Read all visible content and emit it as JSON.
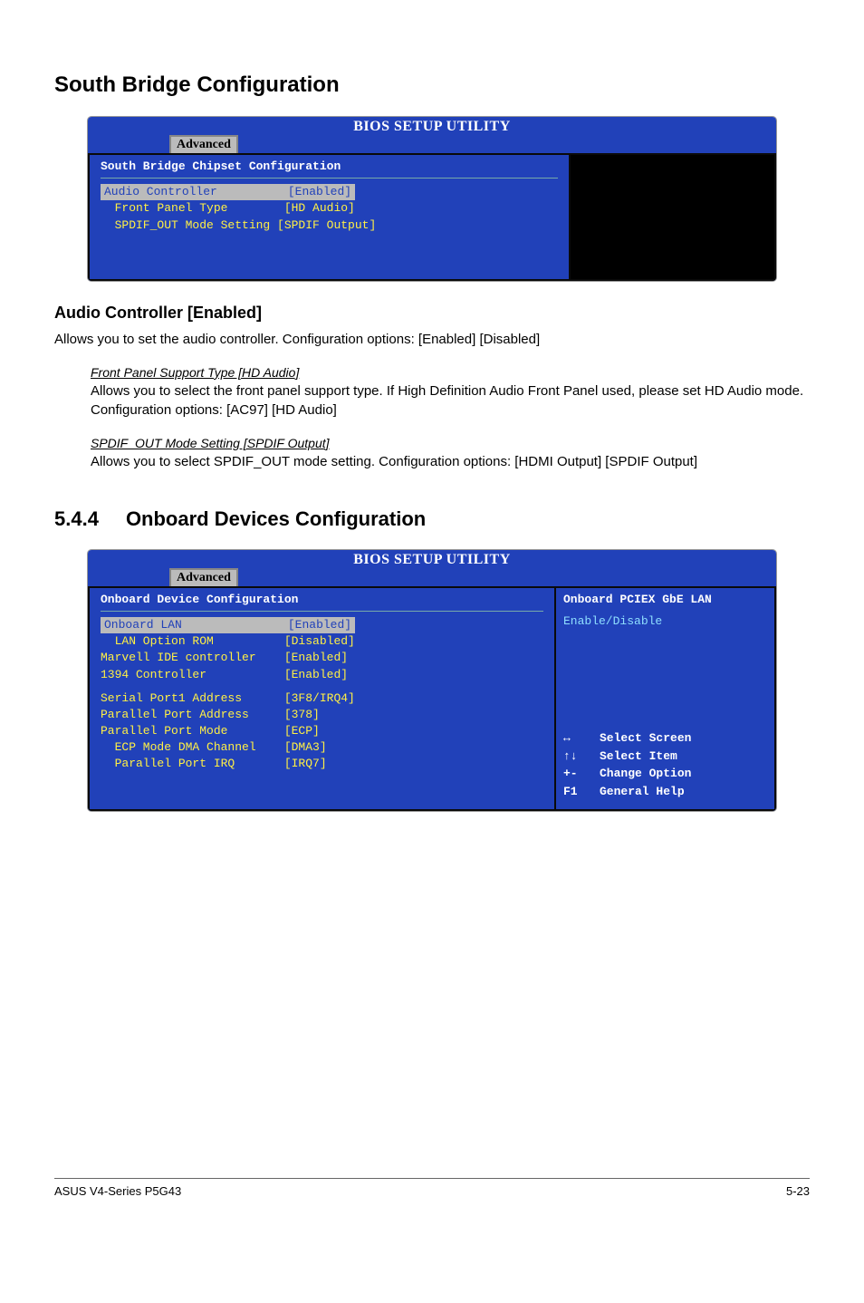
{
  "headings": {
    "south_bridge": "South Bridge Configuration",
    "audio_controller": "Audio Controller [Enabled]",
    "section_num": "5.4.4",
    "section_title": "Onboard Devices Configuration"
  },
  "body": {
    "audio_desc": "Allows you to set the audio controller. Configuration options: [Enabled] [Disabled]",
    "front_panel_title": "Front Panel Support Type [HD Audio]",
    "front_panel_desc": "Allows you to select the front panel support type. If High Definition Audio Front Panel used, please set HD Audio mode. Configuration options: [AC97] [HD Audio]",
    "spdif_title": "SPDIF_OUT Mode Setting [SPDIF Output]",
    "spdif_desc": "Allows you to select SPDIF_OUT mode setting. Configuration options: [HDMI Output] [SPDIF Output]"
  },
  "bios_common": {
    "title": "BIOS SETUP UTILITY",
    "tab": "Advanced"
  },
  "bios1": {
    "section": "South Bridge Chipset Configuration",
    "sel_label": "Audio Controller",
    "sel_val": "[Enabled]",
    "row1": "  Front Panel Type        [HD Audio]",
    "row2": "  SPDIF_OUT Mode Setting [SPDIF Output]"
  },
  "bios2": {
    "section": "Onboard Device Configuration",
    "hint_title": "Onboard PCIEX GbE LAN",
    "hint_body": "Enable/Disable",
    "sel_label": "Onboard LAN",
    "sel_val": "[Enabled]",
    "row_a": "  LAN Option ROM          [Disabled]",
    "row_b": "Marvell IDE controller    [Enabled]",
    "row_c": "1394 Controller           [Enabled]",
    "row_d": "Serial Port1 Address      [3F8/IRQ4]",
    "row_e": "Parallel Port Address     [378]",
    "row_f": "Parallel Port Mode        [ECP]",
    "row_g": "  ECP Mode DMA Channel    [DMA3]",
    "row_h": "  Parallel Port IRQ       [IRQ7]",
    "nav": {
      "k1": "↔",
      "l1": "Select Screen",
      "k2": "↑↓",
      "l2": "Select Item",
      "k3": "+-",
      "l3": "Change Option",
      "k4": "F1",
      "l4": "General Help"
    }
  },
  "footer": {
    "left": "ASUS V4-Series P5G43",
    "right": "5-23"
  }
}
